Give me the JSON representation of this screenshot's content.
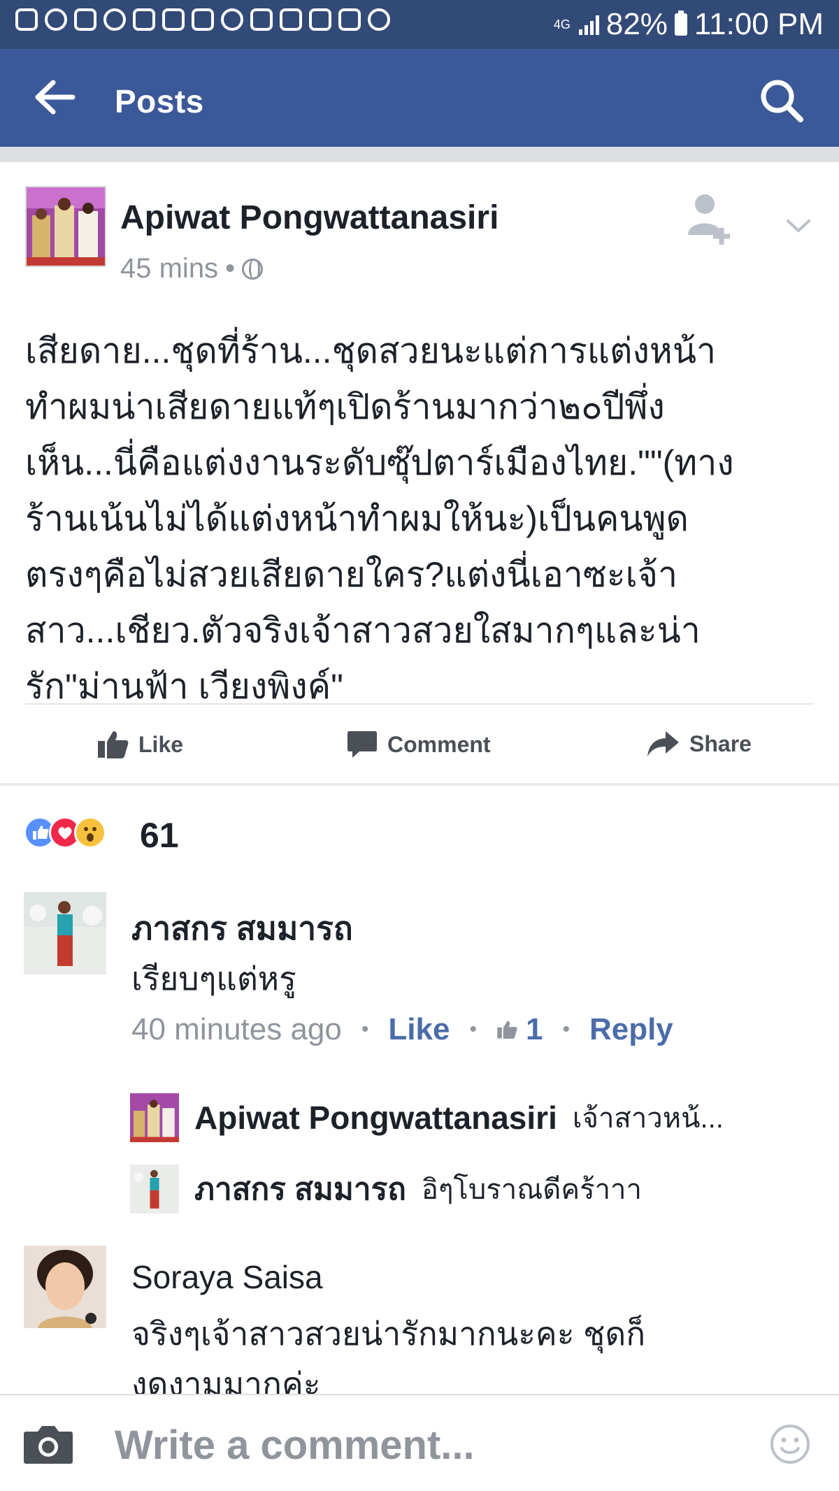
{
  "status_bar": {
    "network": "4G",
    "battery": "82%",
    "time": "11:00 PM"
  },
  "appbar": {
    "title": "Posts"
  },
  "post": {
    "author": "Apiwat Pongwattanasiri",
    "time": "45 mins",
    "text_lines": [
      "เสียดาย...ชุดที่ร้าน...ชุดสวยนะแต่การแต่งหน้า",
      "ทำผมน่าเสียดายแท้ๆเปิดร้านมากว่า๒๐ปีพึ่ง",
      "เห็น...นี่คือแต่งงานระดับซุ๊ปตาร์เมืองไทย.\"\"(ทาง",
      "ร้านเน้นไม่ได้แต่งหน้าทำผมให้นะ)เป็นคนพูด",
      "ตรงๆคือไม่สวยเสียดายใคร?แต่งนี่เอาซะเจ้า",
      "สาว...เชียว.ตัวจริงเจ้าสาวสวยใสมากๆและน่า",
      "รัก\"ม่านฟ้า เวียงพิงค์\""
    ]
  },
  "actions": {
    "like": "Like",
    "comment": "Comment",
    "share": "Share"
  },
  "reactions": {
    "count": "61"
  },
  "comments": [
    {
      "name": "ภาสกร สมมารถ",
      "text": "เรียบๆแต่หรู",
      "time": "40 minutes ago",
      "like": "Like",
      "like_count": "1",
      "reply": "Reply",
      "replies": [
        {
          "name": "Apiwat Pongwattanasiri",
          "text": "เจ้าสาวหน้..."
        },
        {
          "name": "ภาสกร สมมารถ",
          "text": "อิๆโบราณดีคร้าาา"
        }
      ]
    },
    {
      "name": "Soraya Saisa",
      "text_lines": [
        "จริงๆเจ้าสาวสวยน่ารักมากนะคะ ชุดก็",
        "งดงามมากค่ะ"
      ]
    }
  ],
  "composer": {
    "placeholder": "Write a comment..."
  }
}
